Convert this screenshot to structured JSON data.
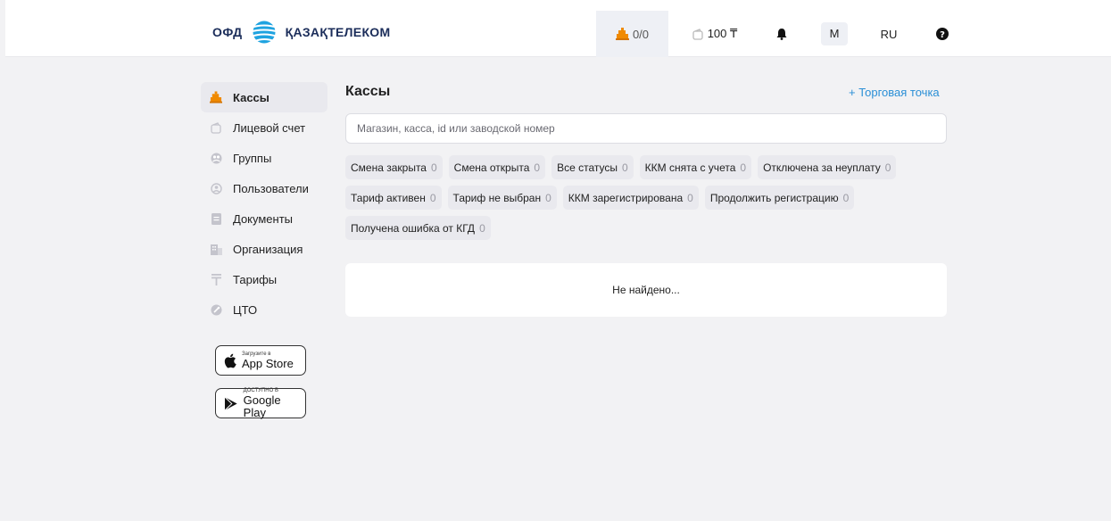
{
  "header": {
    "logo_prefix": "ОФД",
    "logo_name": "ҚАЗАҚТЕЛЕКОМ",
    "kassy_count": "0/0",
    "balance": "100 ₸",
    "user_initial": "M",
    "language": "RU"
  },
  "sidebar": {
    "items": [
      {
        "label": "Кассы",
        "icon": "cash-register-icon",
        "active": true
      },
      {
        "label": "Лицевой счет",
        "icon": "wallet-icon"
      },
      {
        "label": "Группы",
        "icon": "groups-icon"
      },
      {
        "label": "Пользователи",
        "icon": "user-icon"
      },
      {
        "label": "Документы",
        "icon": "document-icon"
      },
      {
        "label": "Организация",
        "icon": "building-icon"
      },
      {
        "label": "Тарифы",
        "icon": "tariff-icon"
      },
      {
        "label": "ЦТО",
        "icon": "service-center-icon"
      }
    ],
    "app_store": {
      "small": "Загрузите в",
      "big": "App Store"
    },
    "google_play": {
      "small": "ДОСТУПНО В",
      "big": "Google Play"
    }
  },
  "main": {
    "title": "Кассы",
    "add_link": "+ Торговая точка",
    "search_placeholder": "Магазин, касса, id или заводской номер",
    "chips": [
      {
        "label": "Смена закрыта",
        "count": "0"
      },
      {
        "label": "Смена открыта",
        "count": "0"
      },
      {
        "label": "Все статусы",
        "count": "0"
      },
      {
        "label": "ККМ снята с учета",
        "count": "0"
      },
      {
        "label": "Отключена за неуплату",
        "count": "0"
      },
      {
        "label": "Тариф активен",
        "count": "0"
      },
      {
        "label": "Тариф не выбран",
        "count": "0"
      },
      {
        "label": "ККМ зарегистрирована",
        "count": "0"
      },
      {
        "label": "Продолжить регистрацию",
        "count": "0"
      },
      {
        "label": "Получена ошибка от КГД",
        "count": "0"
      }
    ],
    "empty_message": "Не найдено..."
  },
  "colors": {
    "accent": "#f08a00",
    "link": "#2a8fd6",
    "brand": "#1b2d5a"
  }
}
